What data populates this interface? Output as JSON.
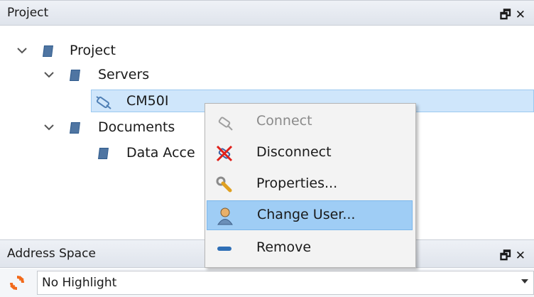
{
  "project_panel": {
    "title": "Project",
    "header_icons": "🗗 ✕"
  },
  "tree": {
    "root": "Project",
    "servers": "Servers",
    "server_item": "CM50I",
    "documents": "Documents",
    "data_access": "Data Acce"
  },
  "context_menu": {
    "items": [
      {
        "label": "Connect",
        "icon": "connect-icon",
        "enabled": false
      },
      {
        "label": "Disconnect",
        "icon": "disconnect-icon",
        "enabled": true
      },
      {
        "label": "Properties...",
        "icon": "wrench-icon",
        "enabled": true
      },
      {
        "label": "Change User...",
        "icon": "user-icon",
        "enabled": true,
        "highlighted": true
      },
      {
        "label": "Remove",
        "icon": "minus-icon",
        "enabled": true
      }
    ]
  },
  "address_panel": {
    "title": "Address Space",
    "header_icons": "🗗 ✕"
  },
  "highlight_combo": {
    "value": "No Highlight"
  },
  "colors": {
    "selection": "#cfe6fb",
    "menu_highlight": "#9fcdf5",
    "folder": "#2e5a8c"
  }
}
